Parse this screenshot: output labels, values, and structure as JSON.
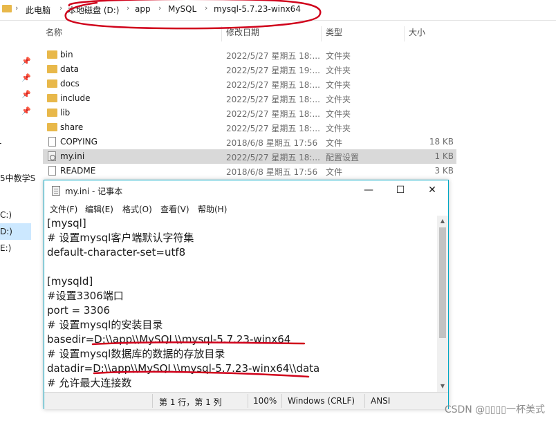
{
  "explorer": {
    "breadcrumb": [
      "此电脑",
      "本地磁盘 (D:)",
      "app",
      "MySQL",
      "mysql-5.7.23-winx64"
    ],
    "columns": {
      "name": "名称",
      "date": "修改日期",
      "type": "类型",
      "size": "大小"
    },
    "sidebar": {
      "item1": "5中教学S",
      "drive_c": "C:)",
      "drive_d": "D:)",
      "drive_e": "E:)"
    },
    "files": [
      {
        "name": "bin",
        "date": "2022/5/27 星期五 18:...",
        "type": "文件夹",
        "size": "",
        "icon": "folder"
      },
      {
        "name": "data",
        "date": "2022/5/27 星期五 19:...",
        "type": "文件夹",
        "size": "",
        "icon": "folder"
      },
      {
        "name": "docs",
        "date": "2022/5/27 星期五 18:...",
        "type": "文件夹",
        "size": "",
        "icon": "folder"
      },
      {
        "name": "include",
        "date": "2022/5/27 星期五 18:...",
        "type": "文件夹",
        "size": "",
        "icon": "folder"
      },
      {
        "name": "lib",
        "date": "2022/5/27 星期五 18:...",
        "type": "文件夹",
        "size": "",
        "icon": "folder"
      },
      {
        "name": "share",
        "date": "2022/5/27 星期五 18:...",
        "type": "文件夹",
        "size": "",
        "icon": "folder"
      },
      {
        "name": "COPYING",
        "date": "2018/6/8 星期五 17:56",
        "type": "文件",
        "size": "18 KB",
        "icon": "file"
      },
      {
        "name": "my.ini",
        "date": "2022/5/27 星期五 18:...",
        "type": "配置设置",
        "size": "1 KB",
        "icon": "ini"
      },
      {
        "name": "README",
        "date": "2018/6/8 星期五 17:56",
        "type": "文件",
        "size": "3 KB",
        "icon": "file"
      }
    ]
  },
  "notepad": {
    "title": "my.ini - 记事本",
    "menu": [
      "文件(F)",
      "编辑(E)",
      "格式(O)",
      "查看(V)",
      "帮助(H)"
    ],
    "lines": [
      "[mysql]",
      "# 设置mysql客户端默认字符集",
      "default-character-set=utf8",
      "",
      "[mysqld]",
      "#设置3306端口",
      "port = 3306",
      "# 设置mysql的安装目录",
      "basedir=D:\\\\app\\\\MySQL\\\\mysql-5.7.23-winx64",
      "# 设置mysql数据库的数据的存放目录",
      "datadir=D:\\\\app\\\\MySQL\\\\mysql-5.7.23-winx64\\\\data",
      "# 允许最大连接数"
    ],
    "status": {
      "position": "第 1 行，第 1 列",
      "zoom": "100%",
      "eol": "Windows (CRLF)",
      "encoding": "ANSI"
    }
  },
  "watermark": "CSDN @▯▯▯▯一杯美式",
  "colors": {
    "folder": "#e8b84a",
    "selection": "#cce8ff",
    "notepad_border": "#00a7c4",
    "annotation": "#d0021b"
  }
}
